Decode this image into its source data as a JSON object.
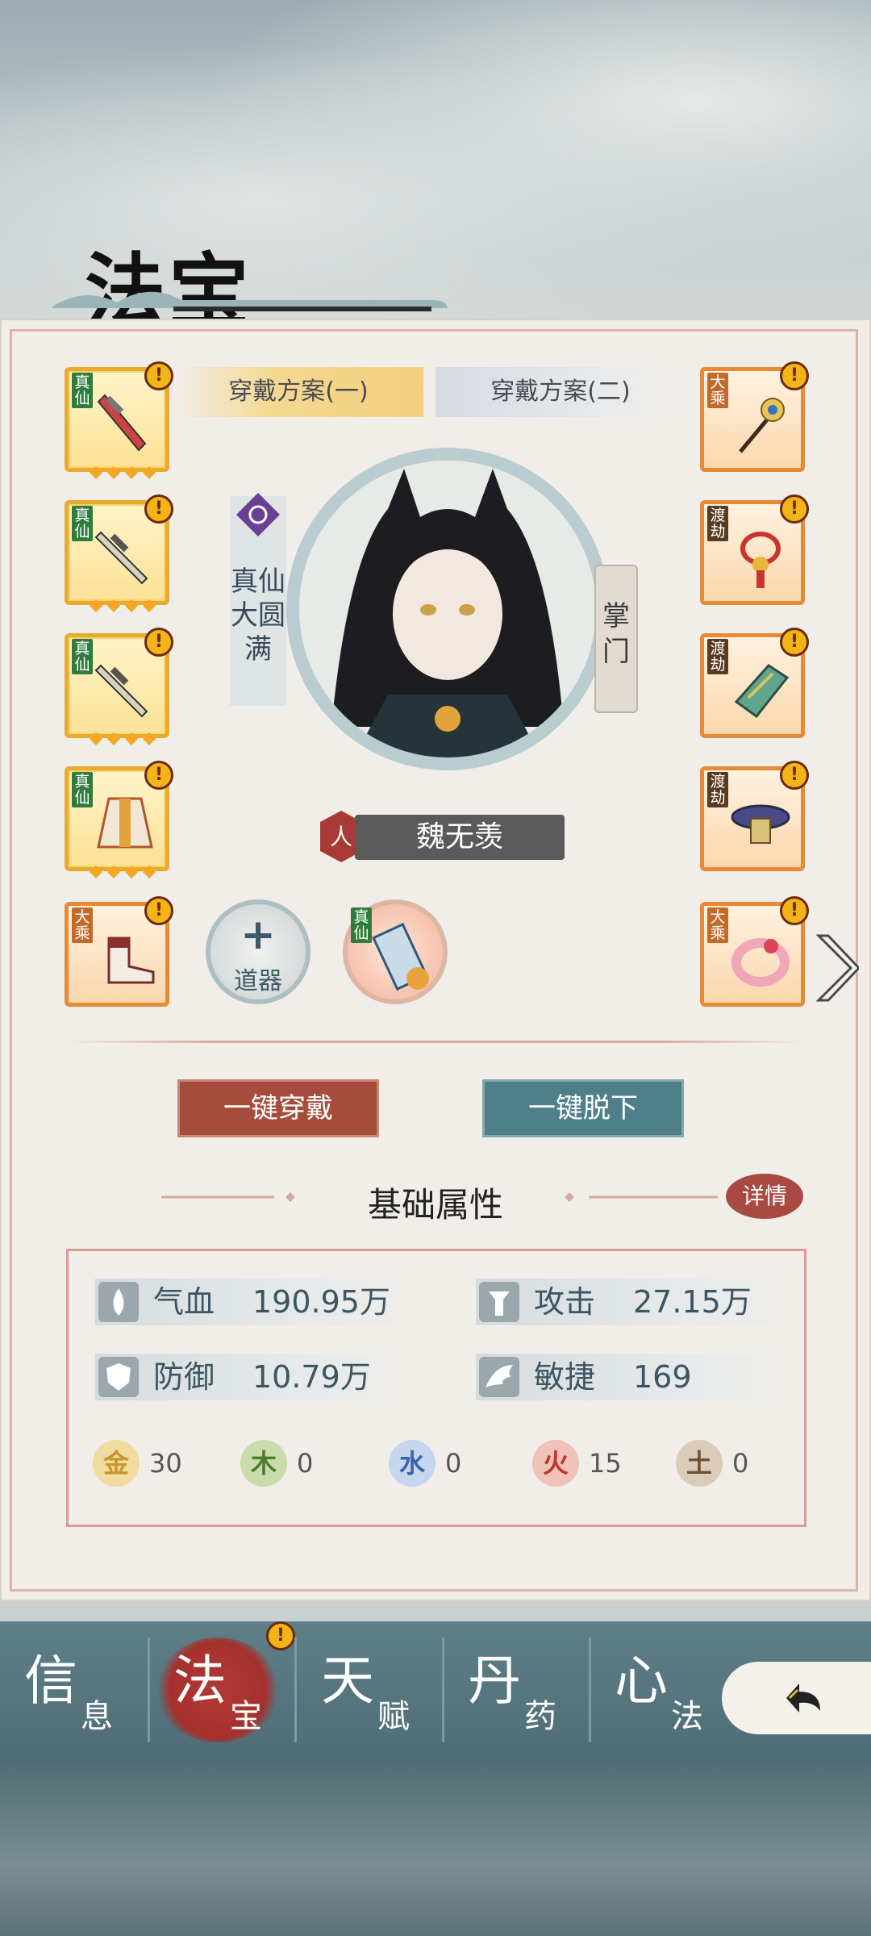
{
  "page": {
    "title": "法宝"
  },
  "tabs": [
    {
      "label": "穿戴方案(一)",
      "active": true
    },
    {
      "label": "穿戴方案(二)",
      "active": false
    }
  ],
  "left_slots": [
    {
      "rank": "真仙",
      "item": "sword-icon",
      "alert": "!"
    },
    {
      "rank": "真仙",
      "item": "sword-icon",
      "alert": "!"
    },
    {
      "rank": "真仙",
      "item": "sword-icon",
      "alert": "!"
    },
    {
      "rank": "真仙",
      "item": "robe-icon",
      "alert": "!"
    },
    {
      "rank": "大乘",
      "item": "boots-icon",
      "alert": "!"
    }
  ],
  "right_slots": [
    {
      "rank": "大乘",
      "item": "hairpin-icon",
      "alert": "!"
    },
    {
      "rank": "渡劫",
      "item": "charm-knot-icon",
      "alert": "!"
    },
    {
      "rank": "渡劫",
      "item": "armguard-icon",
      "alert": "!"
    },
    {
      "rank": "渡劫",
      "item": "belt-icon",
      "alert": "!"
    },
    {
      "rank": "大乘",
      "item": "ring-icon",
      "alert": "!"
    }
  ],
  "character": {
    "realm": "真仙大圆满",
    "role": "掌门",
    "race": "人",
    "name": "魏无羡"
  },
  "tool_button": {
    "plus": "+",
    "label": "道器"
  },
  "talisman": {
    "rank": "真仙"
  },
  "actions": {
    "equip_all": "一键穿戴",
    "unequip_all": "一键脱下"
  },
  "section": {
    "title": "基础属性",
    "detail": "详情"
  },
  "stats": {
    "hp": {
      "label": "气血",
      "value": "190.95万"
    },
    "attack": {
      "label": "攻击",
      "value": "27.15万"
    },
    "defense": {
      "label": "防御",
      "value": "10.79万"
    },
    "agility": {
      "label": "敏捷",
      "value": "169"
    }
  },
  "elements": [
    {
      "glyph": "金",
      "value": "30",
      "color": "#e0b44a"
    },
    {
      "glyph": "木",
      "value": "0",
      "color": "#6c9a3d"
    },
    {
      "glyph": "水",
      "value": "0",
      "color": "#4a78b8"
    },
    {
      "glyph": "火",
      "value": "15",
      "color": "#c8453a"
    },
    {
      "glyph": "土",
      "value": "0",
      "color": "#8a6a45"
    }
  ],
  "nav": [
    {
      "big": "信",
      "small": "息"
    },
    {
      "big": "法",
      "small": "宝",
      "active": true
    },
    {
      "big": "天",
      "small": "赋"
    },
    {
      "big": "丹",
      "small": "药"
    },
    {
      "big": "心",
      "small": "法"
    }
  ],
  "nav_alert": "!"
}
